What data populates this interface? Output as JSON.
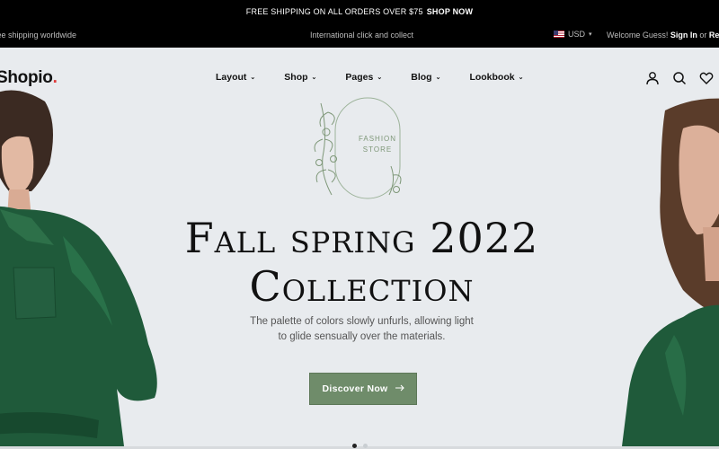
{
  "announcement": {
    "text": "FREE SHIPPING ON ALL ORDERS OVER $75",
    "link": "SHOP NOW"
  },
  "topbar": {
    "left_text": "Free shipping worldwide",
    "center_text": "International click and collect",
    "currency": "USD",
    "welcome_prefix": "Welcome Guess!",
    "sign_in": "Sign In",
    "or": "or",
    "register": "Register"
  },
  "header": {
    "logo": "Shopio",
    "logo_dot": ".",
    "nav": [
      {
        "label": "Layout"
      },
      {
        "label": "Shop"
      },
      {
        "label": "Pages"
      },
      {
        "label": "Blog"
      },
      {
        "label": "Lookbook"
      }
    ],
    "icons": [
      "user-icon",
      "search-icon",
      "heart-icon"
    ]
  },
  "hero": {
    "badge_line1": "FASHION",
    "badge_line2": "STORE",
    "title_line1": "Fall spring 2022",
    "title_line2": "Collection",
    "subtitle_line1": "The palette of colors slowly unfurls, allowing light",
    "subtitle_line2": "to glide sensually over the materials.",
    "button": "Discover Now",
    "button_icon": "arrow-right-icon",
    "slides_count": 2,
    "active_slide": 1
  },
  "colors": {
    "topbar_bg": "#000000",
    "hero_bg": "#e8ebee",
    "accent_green": "#6f8c6a",
    "dress_green": "#1f5a3a",
    "logo_dot": "#e03b3b"
  }
}
